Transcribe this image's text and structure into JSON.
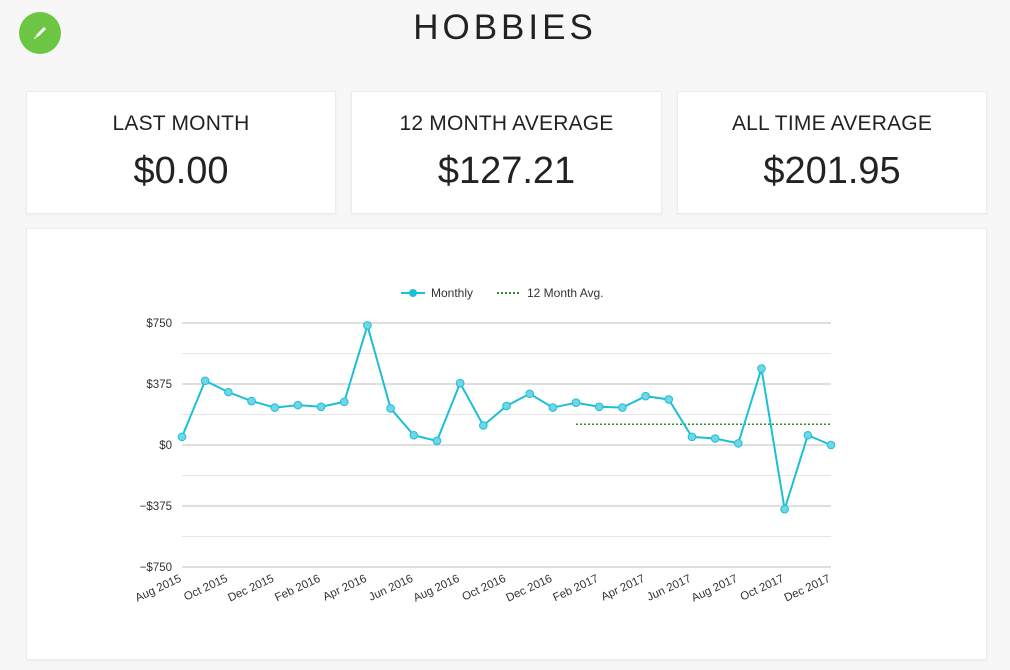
{
  "page": {
    "title": "HOBBIES",
    "edit_icon": "pencil-icon",
    "accent_color": "#6cc644"
  },
  "stats": [
    {
      "label": "LAST MONTH",
      "value": "$0.00"
    },
    {
      "label": "12 MONTH AVERAGE",
      "value": "$127.21"
    },
    {
      "label": "ALL TIME AVERAGE",
      "value": "$201.95"
    }
  ],
  "chart_data": {
    "type": "line",
    "legend": [
      {
        "name": "Monthly",
        "style": "solid-with-markers",
        "color": "#1bbfd6"
      },
      {
        "name": "12 Month Avg.",
        "style": "dotted",
        "color": "#2e8b2e"
      }
    ],
    "legend_position": "top-center",
    "ylim": [
      -750,
      750
    ],
    "yticks": [
      750,
      375,
      0,
      -375,
      -750
    ],
    "ytick_labels": [
      "$750",
      "$375",
      "$0",
      "−$375",
      "−$750"
    ],
    "x": [
      "Aug 2015",
      "Sep 2015",
      "Oct 2015",
      "Nov 2015",
      "Dec 2015",
      "Jan 2016",
      "Feb 2016",
      "Mar 2016",
      "Apr 2016",
      "May 2016",
      "Jun 2016",
      "Jul 2016",
      "Aug 2016",
      "Sep 2016",
      "Oct 2016",
      "Nov 2016",
      "Dec 2016",
      "Jan 2017",
      "Feb 2017",
      "Mar 2017",
      "Apr 2017",
      "May 2017",
      "Jun 2017",
      "Jul 2017",
      "Aug 2017",
      "Sep 2017",
      "Oct 2017",
      "Nov 2017",
      "Dec 2017"
    ],
    "xtick_labels": [
      "Aug 2015",
      "Oct 2015",
      "Dec 2015",
      "Feb 2016",
      "Apr 2016",
      "Jun 2016",
      "Aug 2016",
      "Oct 2016",
      "Dec 2016",
      "Feb 2017",
      "Apr 2017",
      "Jun 2017",
      "Aug 2017",
      "Oct 2017",
      "Dec 2017"
    ],
    "series": [
      {
        "name": "Monthly",
        "values": [
          50,
          395,
          325,
          270,
          230,
          245,
          235,
          265,
          735,
          225,
          60,
          25,
          380,
          120,
          240,
          315,
          230,
          260,
          235,
          230,
          300,
          280,
          50,
          40,
          10,
          470,
          -395,
          60,
          0
        ]
      },
      {
        "name": "12 Month Avg.",
        "x_start": "Jan 2017",
        "x_end": "Dec 2017",
        "value": 127.21
      }
    ],
    "grid": true
  }
}
